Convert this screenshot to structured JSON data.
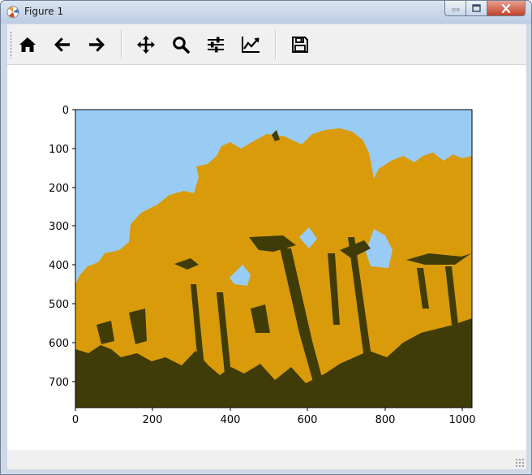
{
  "window": {
    "title": "Figure 1",
    "minimize_icon": "minimize-icon",
    "maximize_icon": "maximize-icon",
    "close_icon": "close-icon"
  },
  "toolbar": {
    "buttons": [
      {
        "id": "home",
        "icon": "home-icon",
        "tooltip": "Reset original view"
      },
      {
        "id": "back",
        "icon": "back-arrow-icon",
        "tooltip": "Back to previous view"
      },
      {
        "id": "forward",
        "icon": "forward-arrow-icon",
        "tooltip": "Forward to next view"
      },
      {
        "id": "pan",
        "icon": "pan-move-icon",
        "tooltip": "Pan axes"
      },
      {
        "id": "zoom",
        "icon": "zoom-magnifier-icon",
        "tooltip": "Zoom to rectangle"
      },
      {
        "id": "subplots",
        "icon": "sliders-icon",
        "tooltip": "Configure subplots"
      },
      {
        "id": "customize",
        "icon": "line-chart-icon",
        "tooltip": "Edit axis, curve and image parameters"
      },
      {
        "id": "save",
        "icon": "floppy-disk-icon",
        "tooltip": "Save the figure"
      }
    ]
  },
  "figure": {
    "image_description_colors": {
      "sky": "#99ccf5",
      "petals": "#d99b0a",
      "stems": "#3f3c08"
    },
    "x_ticks": [
      "0",
      "200",
      "400",
      "600",
      "800",
      "1000"
    ],
    "y_ticks": [
      "0",
      "100",
      "200",
      "300",
      "400",
      "500",
      "600",
      "700"
    ]
  }
}
